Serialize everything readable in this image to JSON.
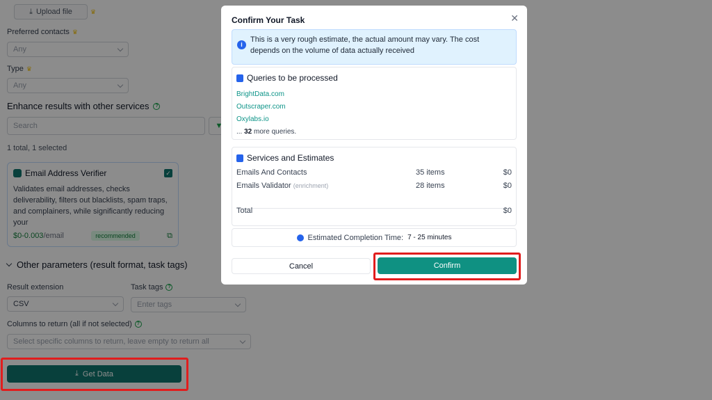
{
  "form": {
    "upload_label": "Upload file",
    "preferred_contacts_label": "Preferred contacts",
    "preferred_contacts_value": "Any",
    "type_label": "Type",
    "type_value": "Any",
    "enhance_title": "Enhance results with other services",
    "search_placeholder": "Search",
    "selection_count": "1 total, 1 selected",
    "other_params_title": "Other parameters (result format, task tags)",
    "result_extension_label": "Result extension",
    "result_extension_value": "CSV",
    "task_tags_label": "Task tags",
    "task_tags_placeholder": "Enter tags",
    "columns_label": "Columns to return (all if not selected)",
    "columns_placeholder": "Select specific columns to return, leave empty to return all",
    "get_data_label": "Get Data"
  },
  "service_card": {
    "title": "Email Address Verifier",
    "description": "Validates email addresses, checks deliverability, filters out blacklists, spam traps, and complainers, while significantly reducing your",
    "price": "$0-0.003",
    "price_unit": "/email",
    "badge": "recommended"
  },
  "modal": {
    "title": "Confirm Your Task",
    "info_text": "This is a very rough estimate, the actual amount may vary. The cost depends on the volume of data actually received",
    "queries_title": "Queries to be processed",
    "queries": [
      "BrightData.com",
      "Outscraper.com",
      "Oxylabs.io"
    ],
    "more_prefix": "...",
    "more_count": "32",
    "more_suffix": "more queries.",
    "services_title": "Services and Estimates",
    "services": [
      {
        "name": "Emails And Contacts",
        "sub": "",
        "items": "35 items",
        "cost": "$0"
      },
      {
        "name": "Emails Validator",
        "sub": "(enrichment)",
        "items": "28 items",
        "cost": "$0"
      }
    ],
    "total_label": "Total",
    "total_cost": "$0",
    "eta_label": "Estimated Completion Time:",
    "eta_value": "7 - 25 minutes",
    "cancel_label": "Cancel",
    "confirm_label": "Confirm"
  },
  "colors": {
    "primary": "#0f766e",
    "confirm": "#0f9182",
    "highlight": "#e11d1d",
    "info_bg": "#e0f2fe"
  }
}
